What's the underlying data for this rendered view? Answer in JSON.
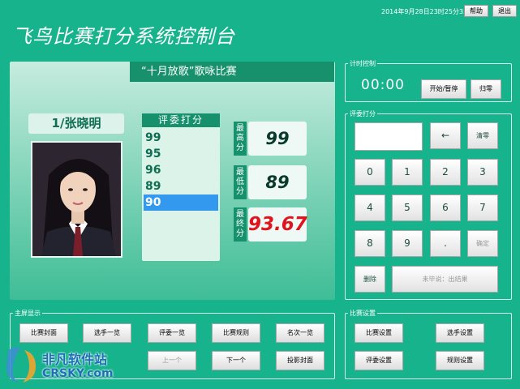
{
  "topbar": {
    "datetime": "2014年9月28日23时25分33秒",
    "help_label": "帮助",
    "exit_label": "退出"
  },
  "app_title": "飞鸟比赛打分系统控制台",
  "stage": {
    "banner": "“十月放歌”歌咏比赛",
    "contestant": "1/张晓明",
    "scores_header": "评委打分",
    "scores": [
      "99",
      "95",
      "96",
      "89",
      "90"
    ],
    "selected_index": 4,
    "max_label": "最高分",
    "max_value": "99",
    "min_label": "最低分",
    "min_value": "89",
    "final_label": "最终分",
    "final_value": "93.67",
    "final_color": "#e0141c"
  },
  "timer": {
    "group_label": "计时控制",
    "display": "00:00",
    "start_pause_label": "开始/暂停",
    "reset_label": "归零"
  },
  "keypad": {
    "group_label": "评委打分",
    "backspace_label": "←",
    "clear_label": "清零",
    "keys": [
      "0",
      "1",
      "2",
      "3",
      "4",
      "5",
      "6",
      "7",
      "8",
      "9",
      "."
    ],
    "confirm_label": "确定",
    "delete_label": "删除",
    "status_label": "未毕说：出结果"
  },
  "main_screen": {
    "group_label": "主屏显示",
    "buttons": [
      "比赛封面",
      "选手一览",
      "评委一览",
      "比赛规则",
      "名次一览"
    ],
    "prev_label": "上一个",
    "next_label": "下一个",
    "projection_label": "投影封面"
  },
  "settings": {
    "group_label": "比赛设置",
    "buttons": [
      "比赛设置",
      "选手设置",
      "评委设置",
      "规则设置"
    ]
  },
  "watermark": {
    "brand": "非凡软件站",
    "domain": "CRSKY.com"
  },
  "colors": {
    "background": "#16b38c",
    "panel_dark": "#17916c",
    "selected": "#3399ee"
  }
}
